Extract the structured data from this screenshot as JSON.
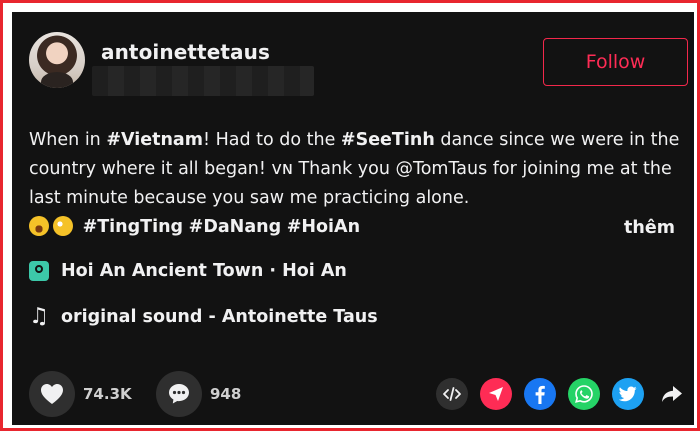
{
  "user": {
    "username": "antoinettetaus"
  },
  "follow_label": "Follow",
  "description": {
    "p1": "When in ",
    "tag1": "#Vietnam",
    "p2": "! Had to do the ",
    "tag2": "#SeeTinh",
    "p3": " dance since we were in the country where it all began! ᴠɴ Thank you @TomTaus for joining me at the last minute because you saw me practicing alone.",
    "tag3": "#TingTing",
    "tag4": "#DaNang",
    "tag5": "#HoiAn"
  },
  "more_label": "thêm",
  "location": "Hoi An Ancient Town · Hoi An",
  "music": "original sound - Antoinette Taus",
  "stats": {
    "likes": "74.3K",
    "comments": "948"
  },
  "colors": {
    "accent": "#fe2c55",
    "frame": "#e8262f",
    "background": "#121212"
  },
  "icons": [
    "heart-icon",
    "comment-icon",
    "embed-icon",
    "send-icon",
    "facebook-icon",
    "whatsapp-icon",
    "twitter-icon",
    "share-arrow-icon"
  ]
}
